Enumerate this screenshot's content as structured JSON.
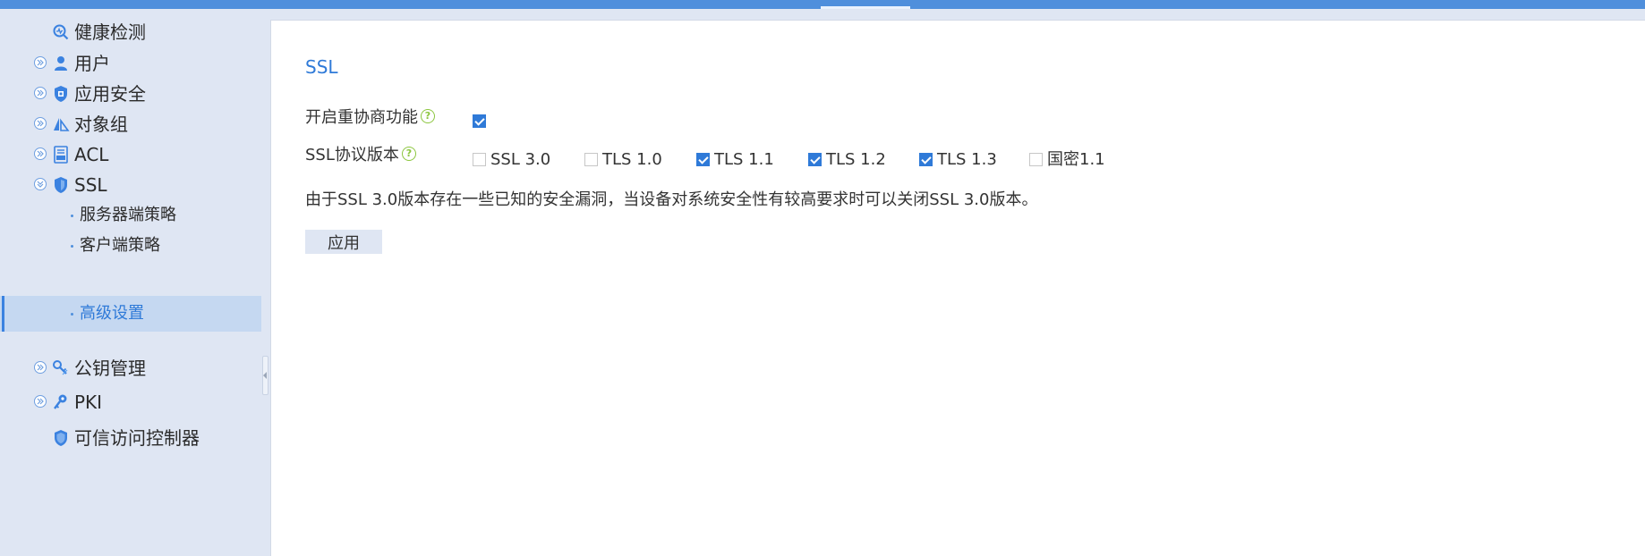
{
  "sidebar": {
    "items": [
      {
        "label": "健康检测",
        "icon": "health-check-icon"
      },
      {
        "label": "用户",
        "icon": "user-icon"
      },
      {
        "label": "应用安全",
        "icon": "app-security-shield-icon"
      },
      {
        "label": "对象组",
        "icon": "object-group-icon"
      },
      {
        "label": "ACL",
        "icon": "acl-document-icon"
      },
      {
        "label": "SSL",
        "icon": "ssl-shield-icon"
      },
      {
        "label": "公钥管理",
        "icon": "key-management-icon"
      },
      {
        "label": "PKI",
        "icon": "pki-key-icon"
      },
      {
        "label": "可信访问控制器",
        "icon": "trusted-access-shield-icon"
      }
    ],
    "ssl_children": [
      {
        "label": "服务器端策略"
      },
      {
        "label": "客户端策略"
      },
      {
        "label": "高级设置",
        "active": true
      }
    ]
  },
  "main": {
    "title": "SSL",
    "renegotiation": {
      "label": "开启重协商功能",
      "checked": true
    },
    "protocol": {
      "label": "SSL协议版本",
      "options": [
        {
          "label": "SSL 3.0",
          "checked": false
        },
        {
          "label": "TLS 1.0",
          "checked": false
        },
        {
          "label": "TLS 1.1",
          "checked": true
        },
        {
          "label": "TLS 1.2",
          "checked": true
        },
        {
          "label": "TLS 1.3",
          "checked": true
        },
        {
          "label": "国密1.1",
          "checked": false
        }
      ]
    },
    "notice": "由于SSL 3.0版本存在一些已知的安全漏洞，当设备对系统安全性有较高要求时可以关闭SSL 3.0版本。",
    "apply_label": "应用",
    "help_glyph": "?"
  },
  "colors": {
    "accent": "#2f7ad8",
    "topbar": "#4f8fdc",
    "sidebar_bg": "#dfe6f3",
    "active_bg": "#c5d8f1",
    "help_green": "#8cc63f"
  }
}
